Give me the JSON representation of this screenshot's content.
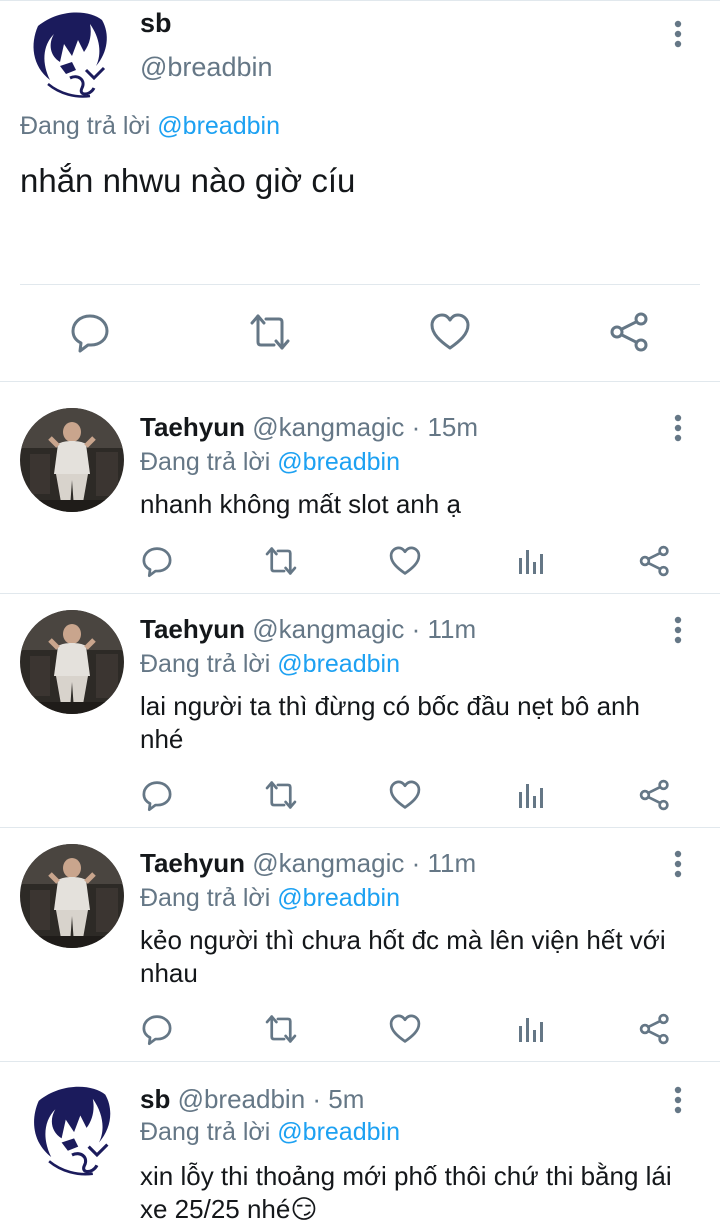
{
  "main_tweet": {
    "name": "sb",
    "handle": "@breadbin",
    "reply_prefix": "Đang trả lời",
    "reply_to": "@breadbin",
    "text": "nhắn nhwu nào giờ cíu"
  },
  "replies": [
    {
      "name": "Taehyun",
      "meta": "@kangmagic · 15m",
      "reply_prefix": "Đang trả lời",
      "reply_to": "@breadbin",
      "text": "nhanh không mất slot anh ạ"
    },
    {
      "name": "Taehyun",
      "meta": "@kangmagic · 11m",
      "reply_prefix": "Đang trả lời",
      "reply_to": "@breadbin",
      "text": "lai người ta thì đừng có bốc đầu nẹt bô anh nhé"
    },
    {
      "name": "Taehyun",
      "meta": "@kangmagic · 11m",
      "reply_prefix": "Đang trả lời",
      "reply_to": "@breadbin",
      "text": "kẻo người thì chưa hốt đc mà lên viện hết với nhau"
    },
    {
      "name": "sb",
      "meta": "@breadbin · 5m",
      "reply_prefix": "Đang trả lời",
      "reply_to": "@breadbin",
      "text": "xin lỗy thi thoảng mới phố thôi chứ thi bằng lái xe 25/25 nhé😏"
    }
  ],
  "icons": {
    "reply": "reply-icon",
    "retweet": "retweet-icon",
    "like": "like-icon",
    "analytics": "analytics-icon",
    "share": "share-icon",
    "more": "more-vertical-icon"
  },
  "colors": {
    "link": "#1da1f2",
    "muted": "#657786",
    "icon": "#657786",
    "divider": "#e1e8ed"
  }
}
